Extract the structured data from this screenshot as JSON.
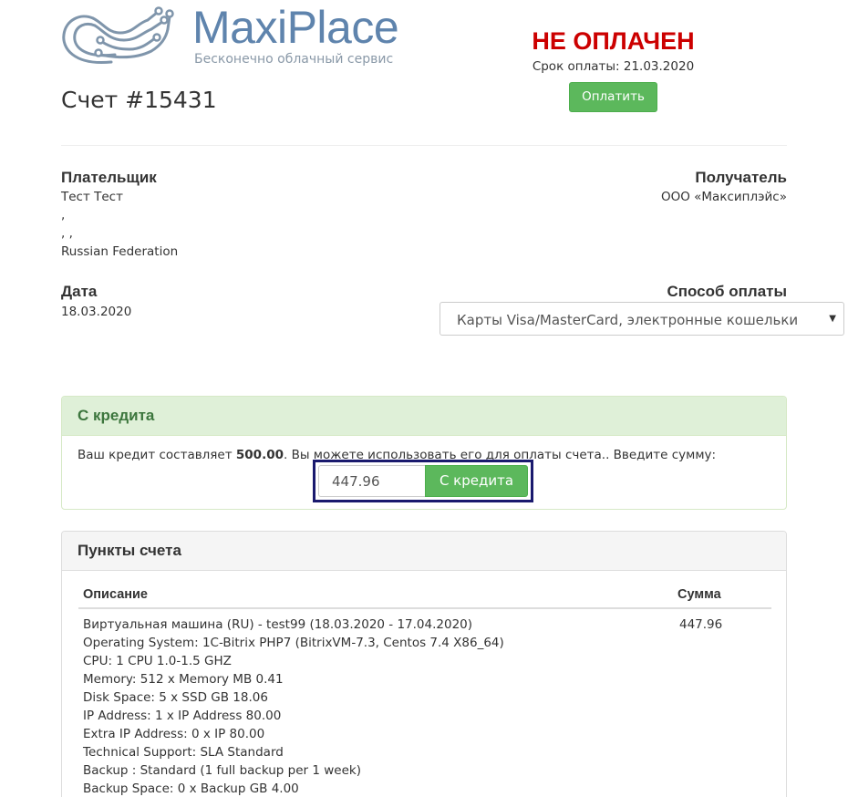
{
  "brand": {
    "name": "MaxiPlace",
    "tagline": "Бесконечно облачный сервис",
    "accent_color": "#5f84ad",
    "logo_icon": "circuit-logo-icon"
  },
  "invoice": {
    "title": "Счет #15431",
    "status": "НЕ ОПЛАЧЕН",
    "status_color": "#cc0000",
    "due_line": "Срок оплаты: 21.03.2020",
    "pay_label": "Оплатить"
  },
  "payer": {
    "heading": "Плательщик",
    "lines": [
      "Тест Тест",
      ",",
      ", ,",
      "Russian Federation"
    ]
  },
  "recipient": {
    "heading": "Получатель",
    "name": "ООО «Максиплэйс»"
  },
  "date": {
    "heading": "Дата",
    "value": "18.03.2020"
  },
  "payment_method": {
    "heading": "Способ оплаты",
    "selected": "Карты Visa/MasterCard, электронные кошельки"
  },
  "credit": {
    "title": "С кредита",
    "text_before": "Ваш кредит составляет ",
    "amount": "500.00",
    "text_after": ". Вы можете использовать его для оплаты счета.. Введите сумму:",
    "input_value": "447.96",
    "apply_label": "С кредита",
    "accent_color": "#5cb85c"
  },
  "items": {
    "title": "Пункты счета",
    "col_description": "Описание",
    "col_sum": "Сумма",
    "rows": [
      {
        "lines": [
          "Виртуальная машина (RU) - test99 (18.03.2020 - 17.04.2020)",
          "Operating System: 1C-Bitrix PHP7 (BitrixVM-7.3, Centos 7.4 X86_64)",
          "CPU: 1 CPU 1.0-1.5 GHZ",
          "Memory: 512 x Memory MB 0.41",
          "Disk Space: 5 x SSD GB 18.06",
          "IP Address: 1 x IP Address 80.00",
          "Extra IP Address: 0 x IP 80.00",
          "Technical Support: SLA Standard",
          "Backup : Standard (1 full backup per 1 week)",
          "Backup Space: 0 x Backup GB 4.00"
        ],
        "sum": "447.96"
      }
    ]
  }
}
